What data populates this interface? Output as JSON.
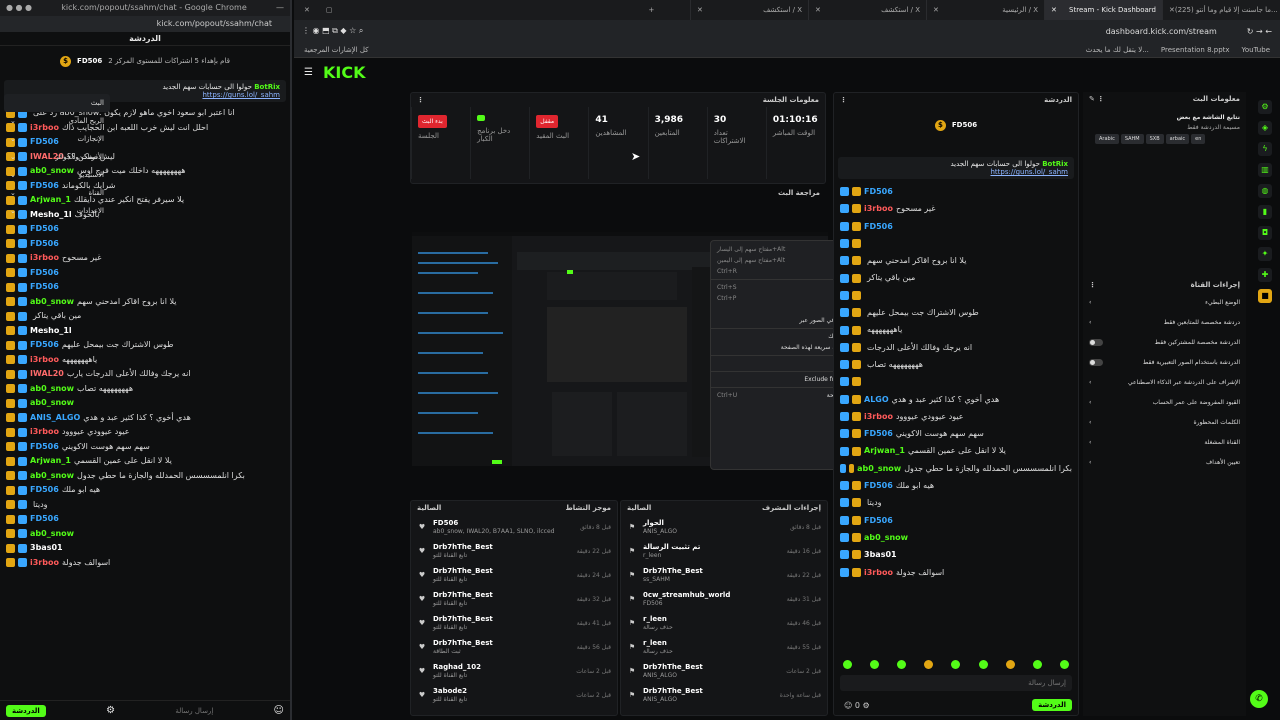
{
  "popout": {
    "window_title": "kick.com/popout/ssahm/chat - Google Chrome",
    "url": "kick.com/popout/ssahm/chat",
    "chat_header": "الدردشة",
    "goal_user": "FD506",
    "goal_text": "قام بإهداء 5 اشتراكات للمستوى المركز 2",
    "pinned_user": "BotRix",
    "pinned_text": "حولوا الى حسابات سهم الجديد",
    "pinned_link": "https://guns.lol/_sahm",
    "messages": [
      {
        "user": "",
        "text": "رد على ab0_snow: انا اعتبر ابو سعود اخوي ماهو لازم يكون",
        "color": "#999"
      },
      {
        "user": "i3rboo",
        "text": "احلل انت ليش خرب اللعبه ابن الحجايب ذاك",
        "color": "#ff5a5a"
      },
      {
        "user": "FD506",
        "text": "",
        "color": "#39a7ff"
      },
      {
        "user": "IWAL20",
        "text": "ليش ممكن ؟؟",
        "color": "#ff6b6b"
      },
      {
        "user": "ab0_snow",
        "text": "ههههههههه داخلك ميت فرح اوس",
        "color": "#53fc18"
      },
      {
        "user": "FD506",
        "text": "شرايك بالكوماند",
        "color": "#39a7ff"
      },
      {
        "user": "Arjwan_1",
        "text": "يلا سيرفر يفتح انكير عندي دايقلك",
        "color": "#53fc18"
      },
      {
        "user": "Mesho_1l",
        "text": "بالخوف",
        "color": "#fff"
      },
      {
        "user": "FD506",
        "text": "",
        "color": "#39a7ff"
      },
      {
        "user": "FD506",
        "text": "",
        "color": "#39a7ff"
      },
      {
        "user": "i3rboo",
        "text": "غير مسحوح",
        "color": "#ff5a5a"
      },
      {
        "user": "FD506",
        "text": "",
        "color": "#39a7ff"
      },
      {
        "user": "FD506",
        "text": "",
        "color": "#39a7ff"
      },
      {
        "user": "ab0_snow",
        "text": "يلا انا بروح اقاكر امدحني سهم",
        "color": "#53fc18"
      },
      {
        "user": "",
        "text": "مين باقي يتاكر",
        "color": "#ddd"
      },
      {
        "user": "Mesho_1l",
        "text": "",
        "color": "#fff"
      },
      {
        "user": "FD506",
        "text": "طوس الاشتراك جت بيمحل عليهم",
        "color": "#39a7ff"
      },
      {
        "user": "i3rboo",
        "text": "ياهههههههه",
        "color": "#ff5a5a"
      },
      {
        "user": "IWAL20",
        "text": "انه يرجك وفالك الأعلى الدرجات يارب",
        "color": "#ff6b6b"
      },
      {
        "user": "ab0_snow",
        "text": "ههههههههه تصاب",
        "color": "#53fc18"
      },
      {
        "user": "ab0_snow",
        "text": "",
        "color": "#53fc18"
      },
      {
        "user": "ANIS_ALGO",
        "text": "هدي أخوي ؟ كذا كثير عبد و هدي",
        "color": "#39a7ff"
      },
      {
        "user": "i3rboo",
        "text": "عيود عيوودي عيووود",
        "color": "#ff5a5a"
      },
      {
        "user": "FD506",
        "text": "سهم سهم هوست الاكويني",
        "color": "#39a7ff"
      },
      {
        "user": "Arjwan_1",
        "text": "يلا لا انقل على عمين القسمي",
        "color": "#53fc18"
      },
      {
        "user": "ab0_snow",
        "text": "بكرا انلمسسسس الحمدلله والجازة ما حطي جدول",
        "color": "#53fc18"
      },
      {
        "user": "FD506",
        "text": "هيه ابو ملك",
        "color": "#39a7ff"
      },
      {
        "user": "",
        "text": "وديتا",
        "color": "#ddd"
      },
      {
        "user": "FD506",
        "text": "",
        "color": "#39a7ff"
      },
      {
        "user": "ab0_snow",
        "text": "",
        "color": "#53fc18"
      },
      {
        "user": "3bas01",
        "text": "",
        "color": "#fff"
      },
      {
        "user": "i3rboo",
        "text": "اسوالف جدولة",
        "color": "#ff5a5a"
      }
    ],
    "input_placeholder": "إرسال رسالة",
    "chat_button": "الدردشة"
  },
  "browser": {
    "tabs": [
      {
        "label": "(225) ما جاسنت إلا قيام وما أنتو...",
        "active": false
      },
      {
        "label": "Stream - Kick Dashboard",
        "active": true
      },
      {
        "label": "الرئيسية / X",
        "active": false
      },
      {
        "label": "استكشف / X",
        "active": false
      },
      {
        "label": "استكشف / X",
        "active": false
      }
    ],
    "url": "dashboard.kick.com/stream",
    "bookmarks": [
      "YouTube",
      "Presentation 8.pptx",
      "لا يتقل لك ما يحدث...",
      "كل الإشارات المرجعية"
    ]
  },
  "kick": {
    "logo": "KICK",
    "nav": [
      {
        "label": "البث",
        "active": true
      },
      {
        "label": "الربح المادي",
        "active": false
      },
      {
        "label": "الإنجازات",
        "active": false
      },
      {
        "label": "الأذونات والجوائز",
        "active": false
      },
      {
        "label": "الاستيديو",
        "active": false
      },
      {
        "label": "القناة",
        "active": false
      },
      {
        "label": "الإعدادات",
        "active": false
      }
    ],
    "session_title": "معلومات الجلسة",
    "stats": [
      {
        "value": "01:10:16",
        "label": "الوقت المباشر"
      },
      {
        "value": "30",
        "label": "تعداد الاشتراكات"
      },
      {
        "value": "3,986",
        "label": "المتابعين"
      },
      {
        "value": "41",
        "label": "المشاهدين"
      },
      {
        "value": "",
        "label": "البث المقيد",
        "button": "مقفل",
        "btn_color": "#e0262f"
      },
      {
        "value": "",
        "label": "دخل برنامج الكبار",
        "button": "",
        "btn_color": "#53fc18"
      },
      {
        "value": "",
        "label": "الجلسة",
        "button": "بدء البث",
        "btn_color": "#e0262f"
      }
    ],
    "preview_title": "مراجعة البث",
    "context_menu": [
      {
        "label": "إلى الوراء",
        "key": "مفتاح سهم إلى اليسار+Alt"
      },
      {
        "label": "إعادة توجيه",
        "key": "مفتاح سهم إلى اليمين+Alt"
      },
      {
        "label": "إعادة تحميل",
        "key": "Ctrl+R"
      },
      {
        "sep": true
      },
      {
        "label": "الحفظ باسم...",
        "key": "Ctrl+S"
      },
      {
        "label": "طباعة...",
        "key": "Ctrl+P"
      },
      {
        "label": "إرسال...",
        "key": ""
      },
      {
        "label": "ابحث في الصور عبر \"Google\"",
        "key": ""
      },
      {
        "sep": true
      },
      {
        "label": "الإرسال إلى أجهزتك",
        "key": ""
      },
      {
        "label": "إنشاء رمز استجابة سريعة لهذه الصفحة",
        "key": ""
      },
      {
        "sep": true
      },
      {
        "label": "ترجمة إلى العربية",
        "key": ""
      },
      {
        "sep": true
      },
      {
        "label": "Exclude from dark mode",
        "key": ""
      },
      {
        "sep": true
      },
      {
        "label": "عرض مصدر الصفحة",
        "key": "Ctrl+U"
      },
      {
        "label": "فحص",
        "key": ""
      }
    ],
    "moderators_feed": {
      "title": "موجز النشاط",
      "tab": "الصالية",
      "items": [
        {
          "name": "FD506",
          "desc": "ab0_snow, IWAL20, B7AA1, SLNO, ilcced",
          "time": "قبل 8 دقائق"
        },
        {
          "name": "Drb7hThe_Best",
          "desc": "تابع القناة للتو",
          "time": "قبل 22 دقيقة"
        },
        {
          "name": "Drb7hThe_Best",
          "desc": "تابع القناة للتو",
          "time": "قبل 24 دقيقة"
        },
        {
          "name": "Drb7hThe_Best",
          "desc": "تابع القناة للتو",
          "time": "قبل 32 دقيقة"
        },
        {
          "name": "Drb7hThe_Best",
          "desc": "تابع القناة للتو",
          "time": "قبل 41 دقيقة"
        },
        {
          "name": "Drb7hThe_Best",
          "desc": "ثبت الطاقة",
          "time": "قبل 56 دقيقة"
        },
        {
          "name": "Raghad_102",
          "desc": "تابع القناة للتو",
          "time": "قبل 2 ساعات"
        },
        {
          "name": "3abode2",
          "desc": "تابع القناة للتو",
          "time": "قبل 2 ساعات"
        }
      ]
    },
    "mod_actions": {
      "title": "إجراءات المشرف",
      "tab": "الصالية",
      "items": [
        {
          "name": "الحوار",
          "desc": "ANIS_ALGO",
          "time": "قبل 8 دقائق"
        },
        {
          "name": "تم تثبيت الرسالة",
          "desc": "r_leen",
          "time": "قبل 16 دقيقة"
        },
        {
          "name": "Drb7hThe_Best",
          "desc": "ss_SAHM",
          "time": "قبل 22 دقيقة"
        },
        {
          "name": "0cw_streamhub_world",
          "desc": "FD506",
          "time": "قبل 31 دقيقة"
        },
        {
          "name": "r_leen",
          "desc": "حذف رسالة",
          "time": "قبل 46 دقيقة"
        },
        {
          "name": "r_leen",
          "desc": "حذف رسالة",
          "time": "قبل 55 دقيقة"
        },
        {
          "name": "Drb7hThe_Best",
          "desc": "ANIS_ALGO",
          "time": "قبل 2 ساعات"
        },
        {
          "name": "Drb7hThe_Best",
          "desc": "ANIS_ALGO",
          "time": "قبل ساعة واحدة"
        }
      ]
    },
    "center_chat": {
      "title": "الدردشة",
      "messages": [
        {
          "user": "FD506",
          "text": "",
          "color": "#39a7ff"
        },
        {
          "user": "i3rboo",
          "text": "غير مسحوح",
          "color": "#ff5a5a"
        },
        {
          "user": "FD506",
          "text": "",
          "color": "#39a7ff"
        },
        {
          "user": "",
          "text": "",
          "color": "#fff"
        },
        {
          "user": "",
          "text": "يلا انا بروح اقاكر امدحني سهم",
          "color": "#ddd"
        },
        {
          "user": "",
          "text": "مين باقي يتاكر",
          "color": "#ddd"
        },
        {
          "user": "",
          "text": "",
          "color": "#fff"
        },
        {
          "user": "",
          "text": "طوس الاشتراك جت بيمحل عليهم",
          "color": "#ddd"
        },
        {
          "user": "",
          "text": "ياهههههههه",
          "color": "#ddd"
        },
        {
          "user": "",
          "text": "انه يرجك وفالك الأعلى الدرجات",
          "color": "#ddd"
        },
        {
          "user": "",
          "text": "ههههههههه تصاب",
          "color": "#ddd"
        },
        {
          "user": "",
          "text": "",
          "color": "#fff"
        },
        {
          "user": "ALGO",
          "text": "هدي أخوي ؟ كذا كثير عبد و هدي",
          "color": "#39a7ff"
        },
        {
          "user": "i3rboo",
          "text": "عيود عيوودي عيووود",
          "color": "#ff5a5a"
        },
        {
          "user": "FD506",
          "text": "سهم سهم هوست الاكويني",
          "color": "#39a7ff"
        },
        {
          "user": "Arjwan_1",
          "text": "يلا لا انقل على عمين القسمي",
          "color": "#53fc18"
        },
        {
          "user": "ab0_snow",
          "text": "بكرا انلمسسسس الحمدلله والجازة ما حطي جدول",
          "color": "#53fc18"
        },
        {
          "user": "FD506",
          "text": "هيه ابو ملك",
          "color": "#39a7ff"
        },
        {
          "user": "",
          "text": "وديتا",
          "color": "#ddd"
        },
        {
          "user": "FD506",
          "text": "",
          "color": "#39a7ff"
        },
        {
          "user": "ab0_snow",
          "text": "",
          "color": "#53fc18"
        },
        {
          "user": "3bas01",
          "text": "",
          "color": "#fff"
        },
        {
          "user": "i3rboo",
          "text": "اسوالف جدولة",
          "color": "#ff5a5a"
        }
      ],
      "input_placeholder": "إرسال رسالة",
      "chat_button": "الدردشة"
    },
    "stream_info": {
      "title": "معلومات البث",
      "stream_name": "نتابع الشاشة مع بعض",
      "category": "مسيمة الدردشة فقط",
      "tags": [
        "Arabic",
        "SAHM",
        "SXB",
        "arbaic",
        "en"
      ]
    },
    "channel_actions": {
      "title": "إجراءات القناة",
      "items": [
        {
          "label": "الوضع البطيء",
          "toggle": false
        },
        {
          "label": "دردشة مخصصة للمتابعين فقط",
          "toggle": false
        },
        {
          "label": "الدردشة مخصصة للمشتركين فقط",
          "toggle": true
        },
        {
          "label": "الدردشة باستخدام الصور التعبيرية فقط",
          "toggle": true
        },
        {
          "label": "الإشراف على الدردشة عبر الذكاء الاصطناعي",
          "toggle": false
        },
        {
          "label": "القيود المفروضة على عمر الحساب",
          "toggle": false
        },
        {
          "label": "الكلمات المحظورة",
          "toggle": false
        },
        {
          "label": "القناة المشغلة",
          "toggle": false
        },
        {
          "label": "تعيين الأهداف",
          "toggle": false
        }
      ]
    }
  },
  "colors": {
    "kick_green": "#53fc18",
    "bg": "#0b0c0d",
    "danger": "#e0262f"
  }
}
